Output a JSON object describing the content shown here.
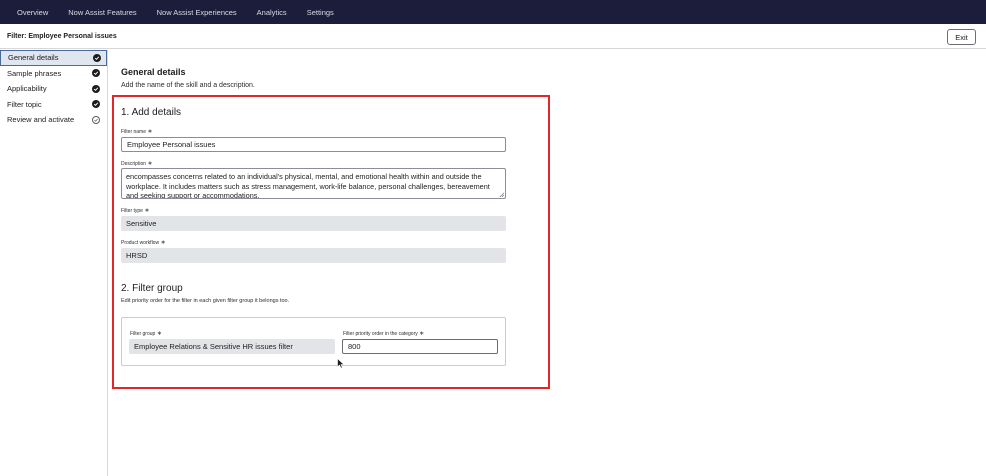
{
  "nav": {
    "items": [
      "Overview",
      "Now Assist Features",
      "Now Assist Experiences",
      "Analytics",
      "Settings"
    ]
  },
  "header": {
    "title": "Filter: Employee Personal issues",
    "exit_label": "Exit"
  },
  "sidebar": {
    "items": [
      {
        "label": "General details",
        "status": "done",
        "active": true
      },
      {
        "label": "Sample phrases",
        "status": "done"
      },
      {
        "label": "Applicability",
        "status": "done"
      },
      {
        "label": "Filter topic",
        "status": "done"
      },
      {
        "label": "Review and activate",
        "status": "pending"
      }
    ]
  },
  "main": {
    "heading": "General details",
    "subheading": "Add the name of the skill and a description.",
    "add_details": {
      "heading": "1. Add details",
      "filter_name_label": "Filter name",
      "filter_name_value": "Employee Personal issues",
      "description_label": "Description",
      "description_value": "encompasses concerns related to an individual's physical, mental, and emotional health within and outside the workplace. It includes matters such as stress management, work-life balance, personal challenges, bereavement and seeking support or accommodations.",
      "filter_type_label": "Filter type",
      "filter_type_value": "Sensitive",
      "product_workflow_label": "Product workflow",
      "product_workflow_value": "HRSD"
    },
    "filter_group": {
      "heading": "2. Filter group",
      "description": "Edit priority order for the filter in each given filter group it belongs too.",
      "group_label": "Filter group",
      "group_value": "Employee Relations & Sensitive HR issues filter",
      "priority_label": "Filter priority order in the category",
      "priority_value": "800"
    },
    "required_marker": "∗"
  },
  "colors": {
    "nav_bg": "#1c1d3a",
    "highlight": "#e0282b",
    "readonly_bg": "#e3e4e7",
    "active_item_bg": "#dfe6ef"
  }
}
